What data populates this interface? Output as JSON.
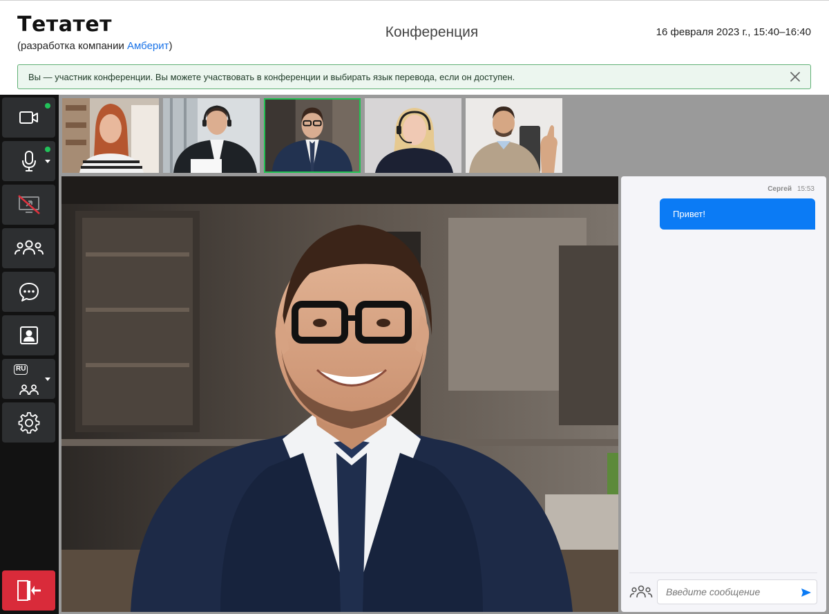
{
  "header": {
    "brand": "Тетатет",
    "subtitle_prefix": "(разработка компании ",
    "subtitle_link": "Амберит",
    "subtitle_suffix": ")",
    "title": "Конференция",
    "datetime": "16 февраля 2023 г., 15:40–16:40"
  },
  "alert": {
    "text": "Вы — участник конференции. Вы можете участвовать в конференции и выбирать язык перевода, если он доступен.",
    "close_icon": "close-icon"
  },
  "sidebar": {
    "items": [
      {
        "name": "camera",
        "icon": "video-camera-icon",
        "status": "on",
        "status_color": "#22c25a"
      },
      {
        "name": "microphone",
        "icon": "microphone-icon",
        "status": "on",
        "status_color": "#22c25a",
        "has_dropdown": true
      },
      {
        "name": "screen-share",
        "icon": "screen-share-off-icon",
        "status": "disabled"
      },
      {
        "name": "participants",
        "icon": "participants-icon"
      },
      {
        "name": "chat",
        "icon": "chat-bubble-icon"
      },
      {
        "name": "contacts",
        "icon": "contact-card-icon"
      },
      {
        "name": "interpretation",
        "icon": "interpreter-icon",
        "language": "RU",
        "has_dropdown": true
      },
      {
        "name": "settings",
        "icon": "gear-icon"
      }
    ],
    "exit": {
      "icon": "exit-door-icon",
      "color": "#d92b3a"
    }
  },
  "thumbnails": [
    {
      "name": "participant-1",
      "active": false
    },
    {
      "name": "participant-2",
      "active": false
    },
    {
      "name": "participant-3",
      "active": true
    },
    {
      "name": "participant-4",
      "active": false
    },
    {
      "name": "participant-5",
      "active": false
    }
  ],
  "chat": {
    "messages": [
      {
        "author": "Сергей",
        "time": "15:53",
        "text": "Привет!"
      }
    ],
    "input_placeholder": "Введите сообщение",
    "accent_color": "#0b7bf5"
  },
  "colors": {
    "active_border": "#21c252",
    "sidebar_bg": "#121212",
    "button_bg": "#2d2f31"
  }
}
